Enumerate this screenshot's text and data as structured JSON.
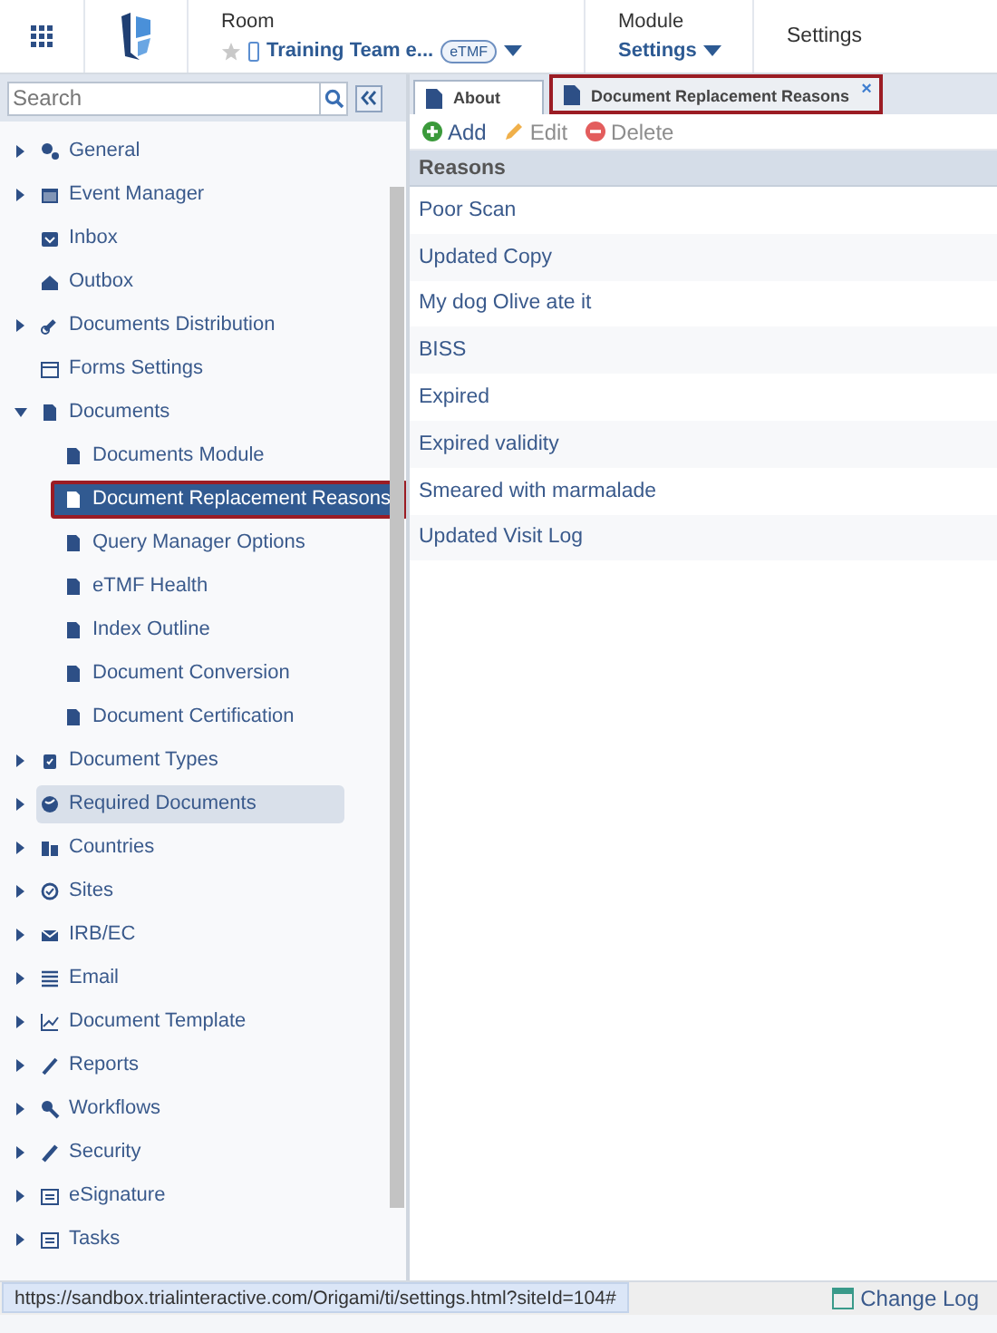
{
  "header": {
    "room_label": "Room",
    "room_name": "Training Team e...",
    "room_badge": "eTMF",
    "module_label": "Module",
    "module_name": "Settings",
    "page_title": "Settings"
  },
  "sidebar": {
    "search": {
      "placeholder": "Search"
    },
    "items": [
      {
        "label": "General",
        "kind": "group",
        "expanded": false,
        "selected": false,
        "hovered": false
      },
      {
        "label": "Event Manager",
        "kind": "group",
        "expanded": false,
        "selected": false,
        "hovered": false
      },
      {
        "label": "Inbox",
        "kind": "leaf",
        "selected": false,
        "hovered": false
      },
      {
        "label": "Outbox",
        "kind": "leaf",
        "selected": false,
        "hovered": false
      },
      {
        "label": "Documents Distribution",
        "kind": "group",
        "expanded": false,
        "selected": false,
        "hovered": false
      },
      {
        "label": "Forms Settings",
        "kind": "leaf",
        "selected": false,
        "hovered": false
      },
      {
        "label": "Documents",
        "kind": "group",
        "expanded": true,
        "selected": false,
        "hovered": false,
        "children": [
          {
            "label": "Documents Module",
            "selected": false
          },
          {
            "label": "Document Replacement Reasons",
            "selected": true
          },
          {
            "label": "Query Manager Options",
            "selected": false
          },
          {
            "label": "eTMF Health",
            "selected": false
          },
          {
            "label": "Index Outline",
            "selected": false
          },
          {
            "label": "Document Conversion",
            "selected": false
          },
          {
            "label": "Document Certification",
            "selected": false
          }
        ]
      },
      {
        "label": "Document Types",
        "kind": "group",
        "expanded": false,
        "selected": false,
        "hovered": false
      },
      {
        "label": "Required Documents",
        "kind": "group",
        "expanded": false,
        "selected": false,
        "hovered": true
      },
      {
        "label": "Countries",
        "kind": "group",
        "expanded": false,
        "selected": false,
        "hovered": false
      },
      {
        "label": "Sites",
        "kind": "group",
        "expanded": false,
        "selected": false,
        "hovered": false
      },
      {
        "label": "IRB/EC",
        "kind": "group",
        "expanded": false,
        "selected": false,
        "hovered": false
      },
      {
        "label": "Email",
        "kind": "group",
        "expanded": false,
        "selected": false,
        "hovered": false
      },
      {
        "label": "Document Template",
        "kind": "group",
        "expanded": false,
        "selected": false,
        "hovered": false
      },
      {
        "label": "Reports",
        "kind": "group",
        "expanded": false,
        "selected": false,
        "hovered": false
      },
      {
        "label": "Workflows",
        "kind": "group",
        "expanded": false,
        "selected": false,
        "hovered": false
      },
      {
        "label": "Security",
        "kind": "group",
        "expanded": false,
        "selected": false,
        "hovered": false
      },
      {
        "label": "eSignature",
        "kind": "group",
        "expanded": false,
        "selected": false,
        "hovered": false
      },
      {
        "label": "Tasks",
        "kind": "group",
        "expanded": false,
        "selected": false,
        "hovered": false
      }
    ]
  },
  "tabs": [
    {
      "label": "About",
      "selected": false
    },
    {
      "label": "Document Replacement Reasons",
      "selected": true,
      "close": "×"
    }
  ],
  "toolbar": [
    {
      "label": "Add",
      "kind": "add",
      "disabled": false
    },
    {
      "label": "Edit",
      "kind": "edit",
      "disabled": true
    },
    {
      "label": "Delete",
      "kind": "delete",
      "disabled": true
    }
  ],
  "table": {
    "columns": [
      "Reasons"
    ],
    "rows": [
      "Poor Scan",
      "Updated Copy",
      "My dog Olive ate it",
      "BISS",
      "Expired",
      "Expired validity",
      "Smeared with marmalade",
      "Updated Visit Log"
    ]
  },
  "status_bar": {
    "url": "https://sandbox.trialinteractive.com/Origami/ti/settings.html?siteId=104#",
    "change_log": "Change Log"
  }
}
